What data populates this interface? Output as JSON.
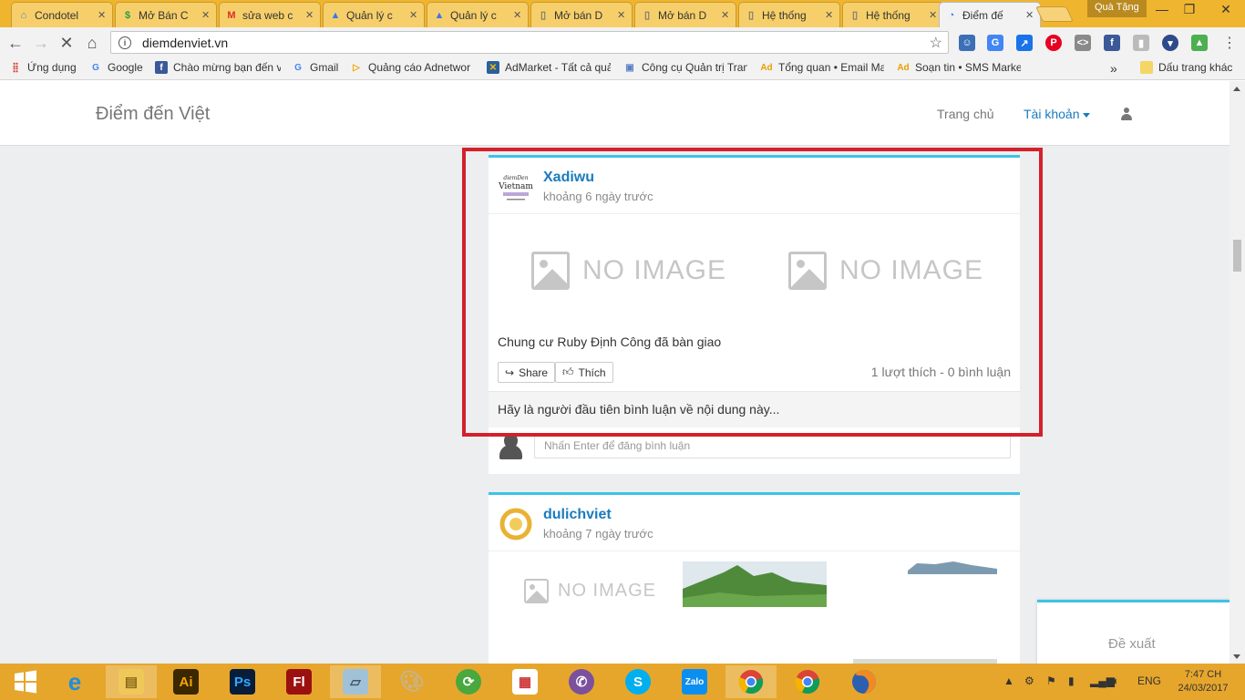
{
  "browser": {
    "tabs": [
      {
        "title": "Condotel",
        "icon": "home-icon",
        "color": "#5b7fc4"
      },
      {
        "title": "Mở Bán C",
        "icon": "dollar-icon",
        "color": "#2e9d3e"
      },
      {
        "title": "sửa web c",
        "icon": "gmail-icon",
        "color": "#d93025"
      },
      {
        "title": "Quản lý c",
        "icon": "adwords-icon",
        "color": "#3b78e7"
      },
      {
        "title": "Quản lý c",
        "icon": "adwords-icon",
        "color": "#3b78e7"
      },
      {
        "title": "Mở bán D",
        "icon": "page-icon",
        "color": "#777777"
      },
      {
        "title": "Mở bán D",
        "icon": "page-icon",
        "color": "#777777"
      },
      {
        "title": "Hệ thống",
        "icon": "page-icon",
        "color": "#777777"
      },
      {
        "title": "Hệ thống",
        "icon": "page-icon",
        "color": "#777777"
      },
      {
        "title": "Điểm đế",
        "icon": "loading-icon",
        "color": "#3b78e7"
      }
    ],
    "gift_label": "Quà Tặng",
    "url": "diemdenviet.vn",
    "bookmarks": [
      {
        "label": "Ứng dụng",
        "icon": "apps-grid-icon"
      },
      {
        "label": "Google",
        "icon": "google-icon"
      },
      {
        "label": "Chào mừng bạn đến v",
        "icon": "facebook-icon"
      },
      {
        "label": "Gmail",
        "icon": "google-icon"
      },
      {
        "label": "Quảng cáo Adnetwor",
        "icon": "adnetwork-icon"
      },
      {
        "label": "AdMarket - Tất cả quả",
        "icon": "admarket-icon"
      },
      {
        "label": "Công cụ Quản trị Tran",
        "icon": "tool-icon"
      },
      {
        "label": "Tổng quan • Email Ma",
        "icon": "ad-icon"
      },
      {
        "label": "Soạn tin • SMS Marke",
        "icon": "ad-icon"
      }
    ],
    "bookmarks_more": "»",
    "other_bookmarks": "Dấu trang khác"
  },
  "site": {
    "brand": "Điểm đến Việt",
    "nav": {
      "home": "Trang chủ",
      "account": "Tài khoản"
    }
  },
  "posts": [
    {
      "user": "Xadiwu",
      "time": "khoảng 6 ngày trước",
      "avatar_text": "diemDen Vietnam",
      "images": [
        "NO IMAGE",
        "NO IMAGE"
      ],
      "description": "Chung cư Ruby Định Công đã bàn giao",
      "share_label": "Share",
      "like_label": "Thích",
      "stats": "1 lượt thích - 0 bình luận",
      "first_comment_prompt": "Hãy là người đầu tiên bình luận về nội dung này...",
      "comment_placeholder": "Nhấn Enter để đăng bình luận"
    },
    {
      "user": "dulichviet",
      "time": "khoảng 7 ngày trước",
      "images": [
        "NO IMAGE"
      ]
    }
  ],
  "suggest_label": "Đề xuất",
  "taskbar": {
    "language": "ENG",
    "time": "7:47 CH",
    "date": "24/03/2017"
  }
}
